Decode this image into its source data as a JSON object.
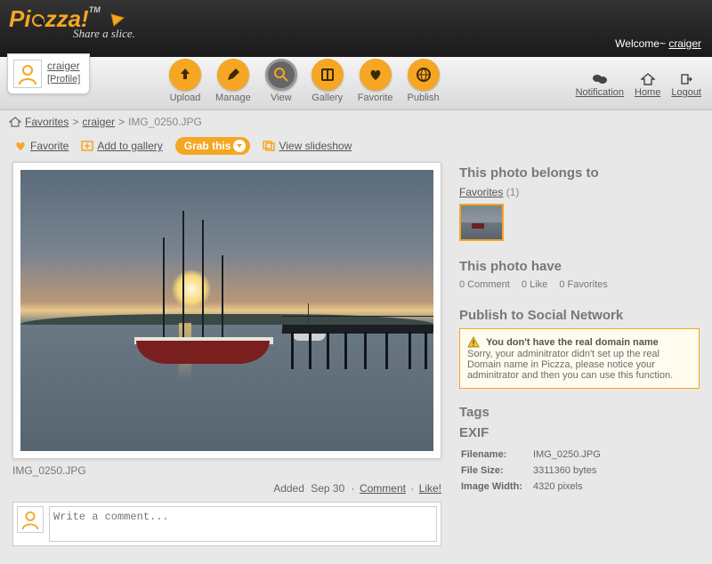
{
  "header": {
    "logo_text_a": "Pi",
    "logo_text_b": "zza!",
    "logo_tm": "TM",
    "tagline": "Share a slice.",
    "welcome_prefix": "Welcome~ ",
    "welcome_user": "craiger"
  },
  "usercard": {
    "username": "craiger",
    "profile_label": "[Profile]"
  },
  "nav": {
    "items": [
      {
        "label": "Upload"
      },
      {
        "label": "Manage"
      },
      {
        "label": "View"
      },
      {
        "label": "Gallery"
      },
      {
        "label": "Favorite"
      },
      {
        "label": "Publish"
      }
    ],
    "right": [
      {
        "label": "Notification"
      },
      {
        "label": "Home"
      },
      {
        "label": "Logout"
      }
    ]
  },
  "breadcrumb": {
    "a": "Favorites",
    "b": "craiger",
    "c": "IMG_0250.JPG",
    "sep": ">"
  },
  "actions": {
    "favorite": "Favorite",
    "add_to_gallery": "Add to gallery",
    "grab_this": "Grab this",
    "view_slideshow": "View slideshow"
  },
  "photo": {
    "filename": "IMG_0250.JPG",
    "added_prefix": "Added ",
    "added_date": "Sep 30",
    "comment_label": "Comment",
    "like_label": "Like!",
    "dot": " · "
  },
  "comment_box": {
    "placeholder": "Write a comment..."
  },
  "sidebar": {
    "belongs_title": "This photo belongs to",
    "owner_link": "Favorites",
    "owner_count": "(1)",
    "have_title": "This photo have",
    "stats": {
      "comments": "0 Comment",
      "likes": "0 Like",
      "favs": "0 Favorites"
    },
    "publish_title": "Publish to Social Network",
    "warn_bold": "You don't have the real domain name",
    "warn_body": "Sorry, your adminitrator didn't set up the real Domain name in Piczza, please notice your adminitrator and then you can use this function.",
    "tags_title": "Tags",
    "exif_title": "EXIF",
    "exif": {
      "rows": [
        {
          "k": "Filename:",
          "v": "IMG_0250.JPG"
        },
        {
          "k": "File Size:",
          "v": "3311360 bytes"
        },
        {
          "k": "Image Width:",
          "v": "4320 pixels"
        }
      ]
    }
  }
}
